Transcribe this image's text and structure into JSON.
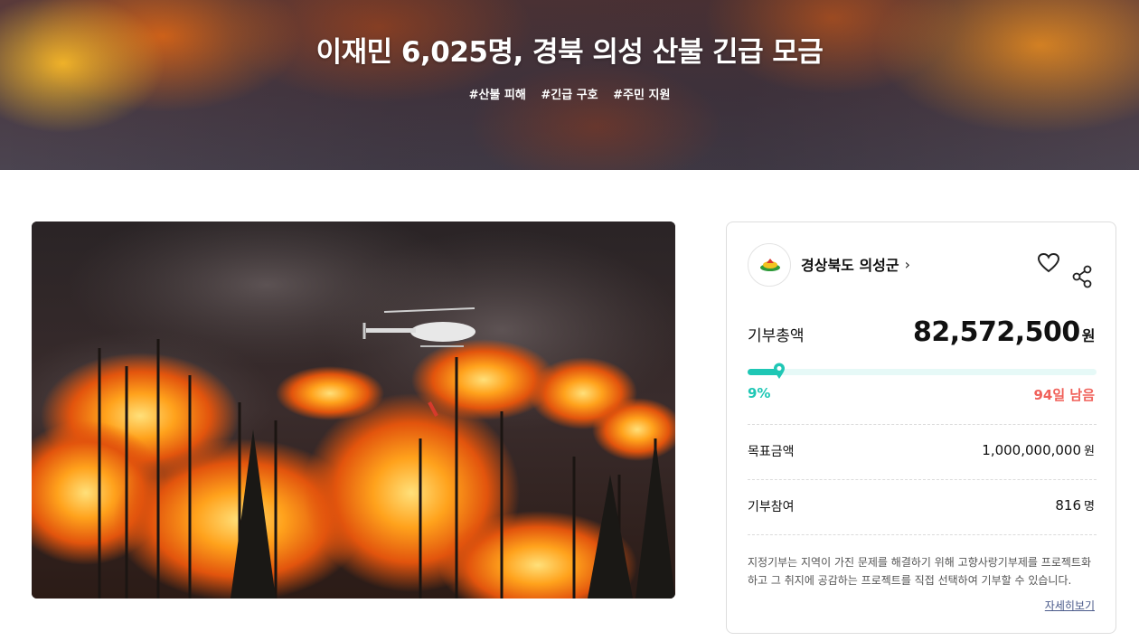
{
  "hero": {
    "title": "이재민 6,025명, 경북 의성 산불 긴급 모금",
    "tags": [
      "#산불 피해",
      "#긴급 구호",
      "#주민 지원"
    ]
  },
  "photo": {
    "subject": "forest fire with helicopter"
  },
  "card": {
    "org_name": "경상북도 의성군",
    "org_chevron": "›",
    "total_label": "기부총액",
    "total_value": "82,572,500",
    "total_unit": "원",
    "progress_percent_label": "9%",
    "progress_fraction": 0.09,
    "remaining_label": "94일 남음",
    "goal_label": "목표금액",
    "goal_value": "1,000,000,000",
    "goal_unit": "원",
    "participants_label": "기부참여",
    "participants_value": "816",
    "participants_unit": "명",
    "description": "지정기부는 지역이 가진 문제를 해결하기 위해 고향사랑기부제를 프로젝트화 하고 그 취지에 공감하는 프로젝트를 직접 선택하여 기부할 수 있습니다.",
    "more_link": "자세히보기"
  },
  "colors": {
    "accent_teal": "#1fc7b5",
    "remaining_red": "#f0615a",
    "track": "#e6f9f7"
  },
  "icons": {
    "heart": "heart-icon",
    "share": "share-icon",
    "chevron": "chevron-right-icon"
  }
}
